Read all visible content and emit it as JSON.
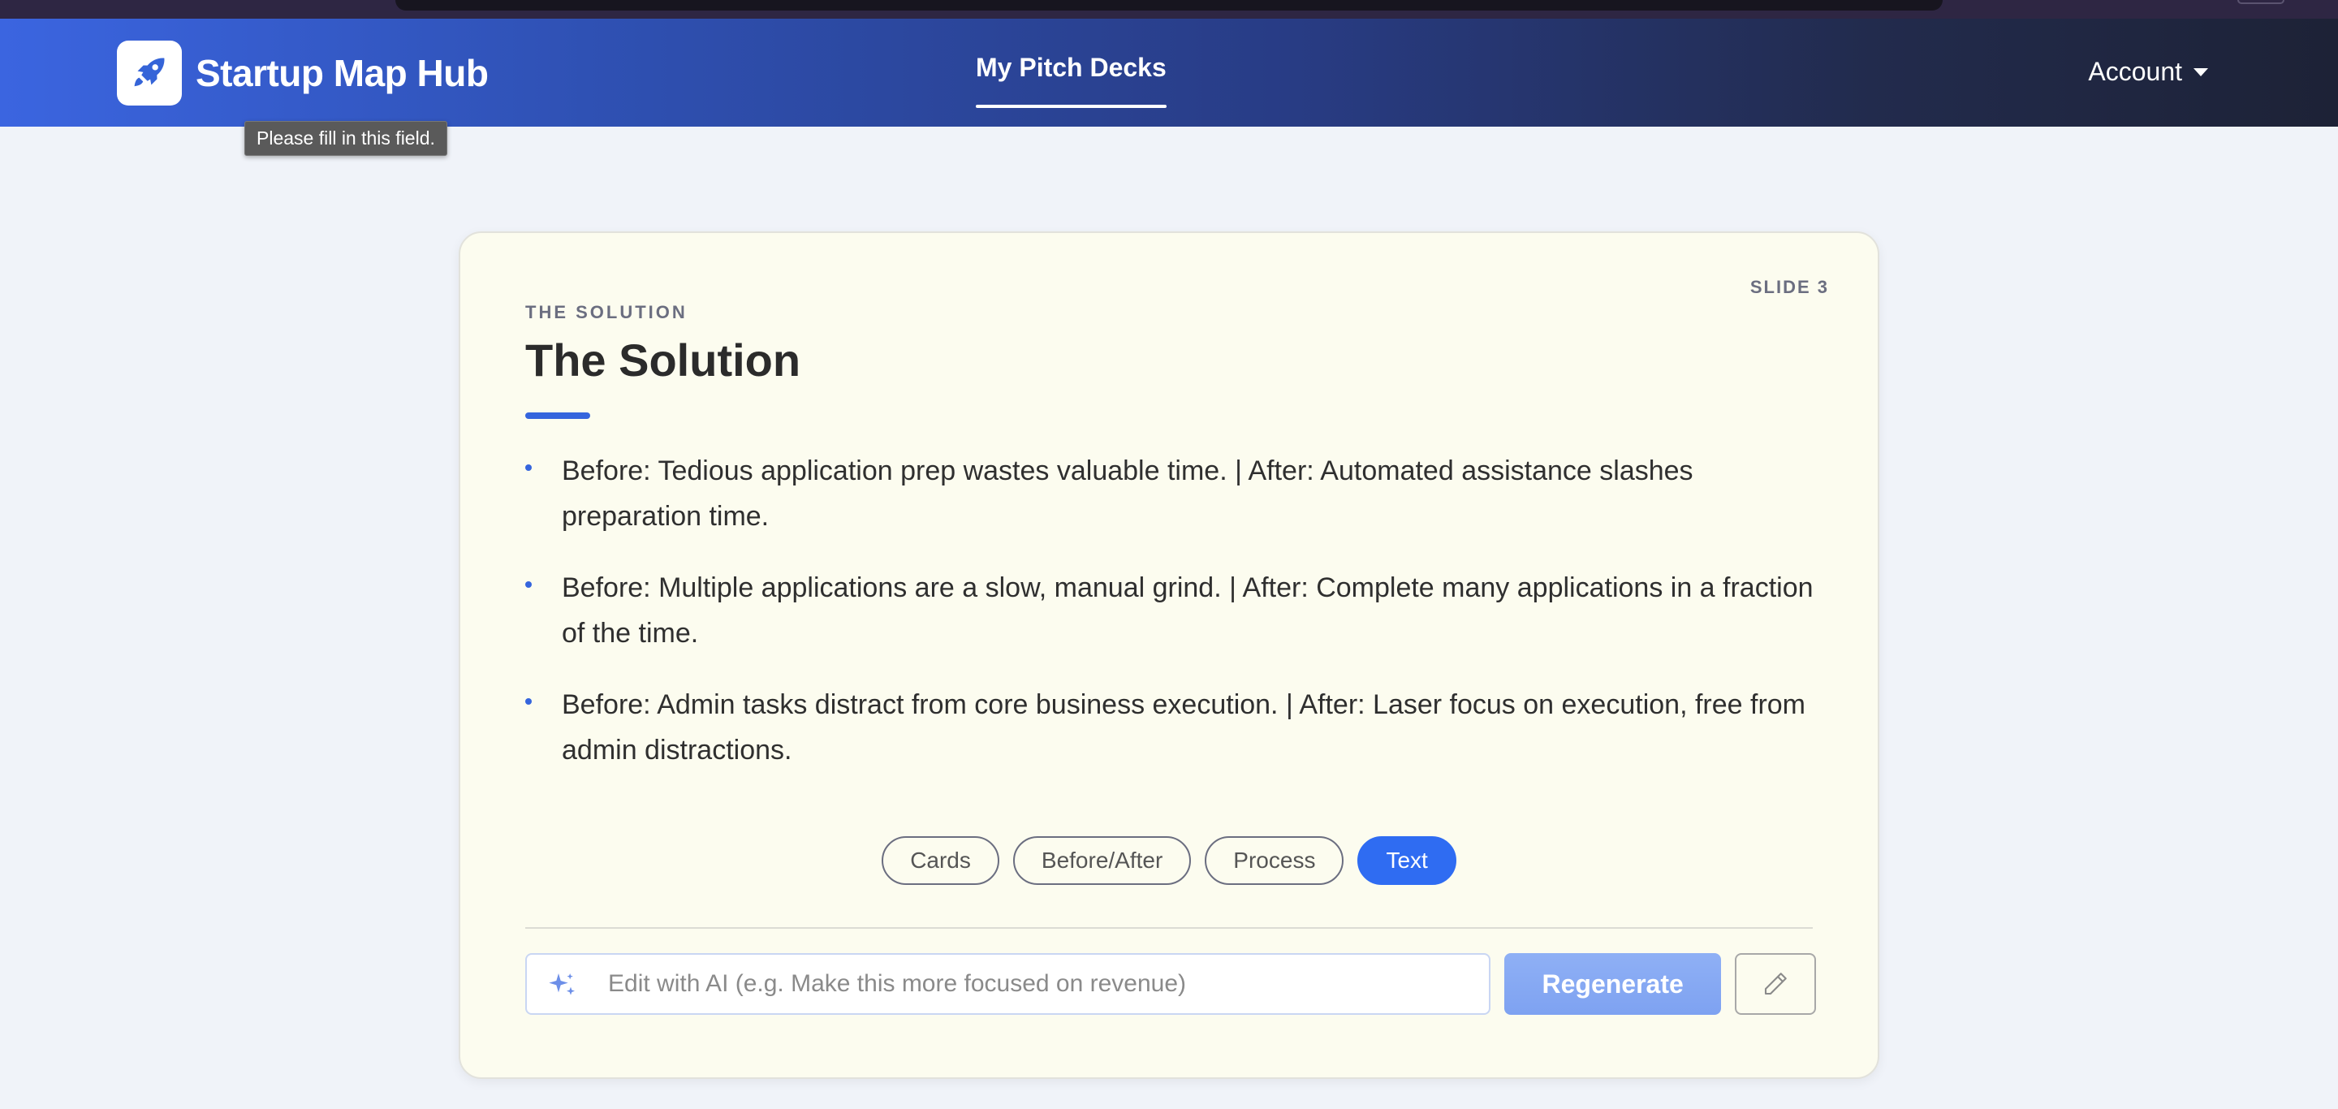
{
  "header": {
    "brand_name": "Startup Map Hub",
    "nav_item": "My Pitch Decks",
    "account_label": "Account"
  },
  "validation_tooltip": "Please fill in this field.",
  "slide": {
    "slide_number_label": "SLIDE 3",
    "eyebrow": "THE SOLUTION",
    "title": "The Solution",
    "bullets": [
      "Before: Tedious application prep wastes valuable time. | After: Automated assistance slashes preparation time.",
      "Before: Multiple applications are a slow, manual grind. | After: Complete many applications in a fraction of the time.",
      "Before: Admin tasks distract from core business execution. | After: Laser focus on execution, free from admin distractions."
    ],
    "layout_options": [
      "Cards",
      "Before/After",
      "Process",
      "Text"
    ],
    "active_layout": "Text"
  },
  "ai_edit": {
    "placeholder": "Edit with AI (e.g. Make this more focused on revenue)",
    "value": "",
    "regenerate_label": "Regenerate"
  },
  "colors": {
    "accent": "#2f6cf2",
    "card_background": "#fcfcef",
    "page_background": "#f0f3f9"
  },
  "icons": {
    "brand": "rocket-icon",
    "ai": "sparkle-icon",
    "edit": "pencil-icon"
  }
}
